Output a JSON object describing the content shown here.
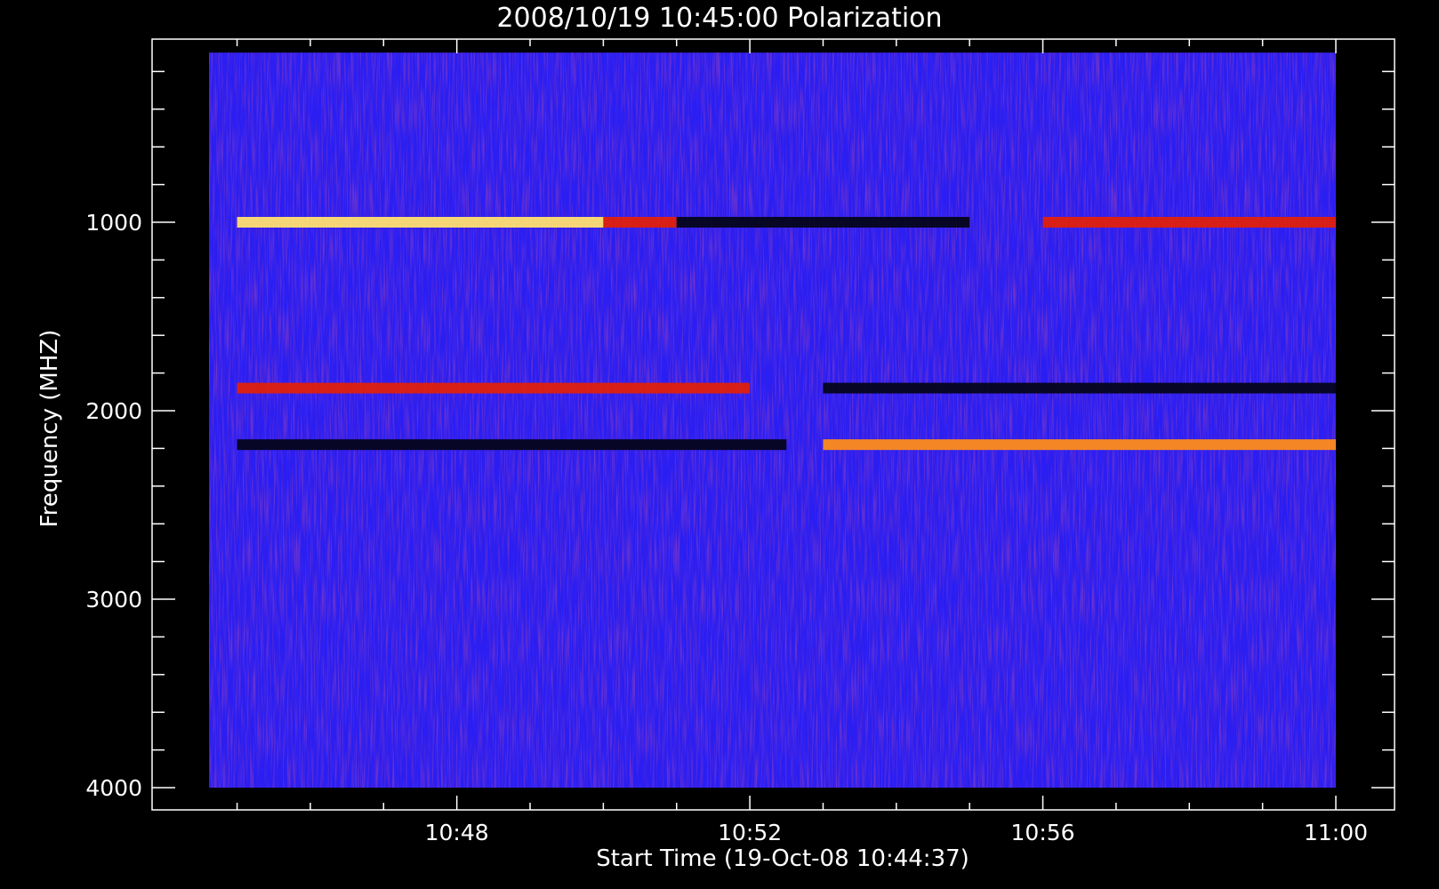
{
  "chart_data": {
    "type": "heatmap",
    "title": "2008/10/19 10:45:00 Polarization",
    "xlabel": "Start Time (19-Oct-08 10:44:37)",
    "ylabel": "Frequency (MHZ)",
    "x_tick_labels": [
      "10:48",
      "10:52",
      "10:56",
      "11:00"
    ],
    "y_tick_labels": [
      "1000",
      "2000",
      "3000",
      "4000"
    ],
    "x_range": [
      "10:44:37",
      "11:00:00"
    ],
    "y_range_mhz": [
      100,
      4000
    ],
    "y_axis_inverted": true,
    "colors": {
      "background": "#000000",
      "axes": "#ffffff",
      "field": "#2a1ef2",
      "noise": "#7a1f8a",
      "dark": "#05051a",
      "bright_red": "#e0200c",
      "orange": "#ff8c1a",
      "yellow": "#ffe070"
    },
    "bands": [
      {
        "freq_mhz": 1000,
        "start": "10:45:00",
        "end": "10:50:00",
        "color": "yellow"
      },
      {
        "freq_mhz": 1000,
        "start": "10:50:00",
        "end": "10:51:00",
        "color": "bright_red"
      },
      {
        "freq_mhz": 1000,
        "start": "10:51:00",
        "end": "10:55:00",
        "color": "dark"
      },
      {
        "freq_mhz": 1000,
        "start": "10:56:00",
        "end": "11:00:00",
        "color": "bright_red"
      },
      {
        "freq_mhz": 1880,
        "start": "10:45:00",
        "end": "10:52:00",
        "color": "bright_red"
      },
      {
        "freq_mhz": 1880,
        "start": "10:53:00",
        "end": "11:00:00",
        "color": "dark"
      },
      {
        "freq_mhz": 2180,
        "start": "10:45:00",
        "end": "10:52:30",
        "color": "dark"
      },
      {
        "freq_mhz": 2180,
        "start": "10:53:00",
        "end": "11:00:00",
        "color": "orange"
      }
    ]
  }
}
